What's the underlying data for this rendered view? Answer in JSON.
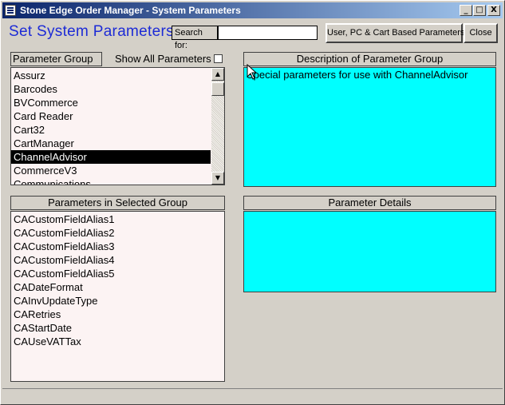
{
  "window": {
    "title": "Stone Edge Order Manager - System Parameters",
    "minimize_glyph": "_",
    "maximize_glyph": "□",
    "close_glyph": "X"
  },
  "header": {
    "heading": "Set System Parameters",
    "search_label": "Search for:",
    "search_value": "",
    "user_pc_cart_button": "User, PC & Cart Based Parameters",
    "close_button": "Close"
  },
  "parameter_group": {
    "header": "Parameter Group",
    "show_all_label": "Show All Parameters",
    "show_all_checked": false,
    "items": [
      "Assurz",
      "Barcodes",
      "BVCommerce",
      "Card Reader",
      "Cart32",
      "CartManager",
      "ChannelAdvisor",
      "CommerceV3",
      "Communications"
    ],
    "selected": "ChannelAdvisor"
  },
  "description": {
    "header": "Description of Parameter Group",
    "text": "Special parameters for use with ChannelAdvisor"
  },
  "parameters": {
    "header": "Parameters in Selected Group",
    "items": [
      "CACustomFieldAlias1",
      "CACustomFieldAlias2",
      "CACustomFieldAlias3",
      "CACustomFieldAlias4",
      "CACustomFieldAlias5",
      "CADateFormat",
      "CAInvUpdateType",
      "CARetries",
      "CAStartDate",
      "CAUseVATTax"
    ]
  },
  "details": {
    "header": "Parameter Details",
    "text": ""
  },
  "colors": {
    "titlebar": "#0a246a",
    "heading": "#1d2bd6",
    "panel_cyan": "#00ffff",
    "listbox_bg": "#fcf3f3",
    "window_bg": "#d4d0c8"
  },
  "icons": {
    "app": "form-icon",
    "scroll_up": "▲",
    "scroll_down": "▼"
  }
}
